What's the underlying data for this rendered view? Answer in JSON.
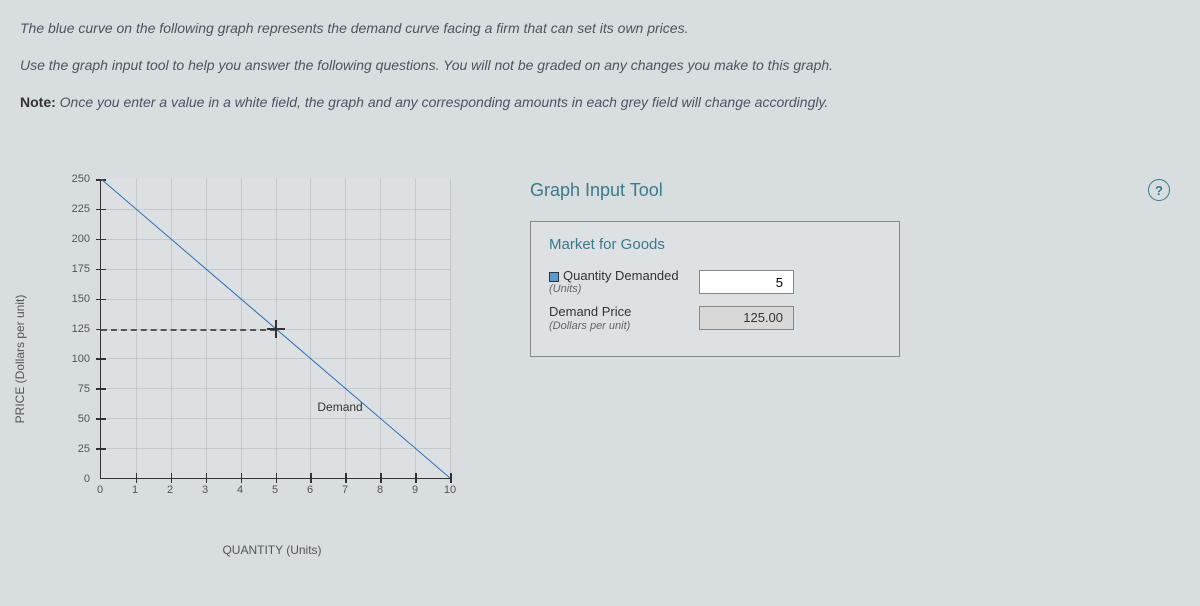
{
  "instructions": {
    "line1": "The blue curve on the following graph represents the demand curve facing a firm that can set its own prices.",
    "line2": "Use the graph input tool to help you answer the following questions. You will not be graded on any changes you make to this graph.",
    "note_label": "Note:",
    "note_text": " Once you enter a value in a white field, the graph and any corresponding amounts in each grey field will change accordingly."
  },
  "chart": {
    "y_label": "PRICE (Dollars per unit)",
    "x_label": "QUANTITY (Units)",
    "demand_label": "Demand",
    "y_ticks": [
      "250",
      "225",
      "200",
      "175",
      "150",
      "125",
      "100",
      "75",
      "50",
      "25",
      "0"
    ],
    "x_ticks": [
      "0",
      "1",
      "2",
      "3",
      "4",
      "5",
      "6",
      "7",
      "8",
      "9",
      "10"
    ]
  },
  "chart_data": {
    "type": "line",
    "title": "",
    "xlabel": "QUANTITY (Units)",
    "ylabel": "PRICE (Dollars per unit)",
    "xlim": [
      0,
      10
    ],
    "ylim": [
      0,
      250
    ],
    "series": [
      {
        "name": "Demand",
        "x": [
          0,
          10
        ],
        "y": [
          250,
          0
        ]
      }
    ],
    "marker": {
      "x": 5,
      "y": 125
    },
    "annotations": [
      {
        "text": "Demand",
        "x": 7,
        "y": 55
      }
    ]
  },
  "tool": {
    "title": "Graph Input Tool",
    "help": "?",
    "section_title": "Market for Goods",
    "quantity": {
      "label": "Quantity Demanded",
      "sublabel": "(Units)",
      "value": "5"
    },
    "price": {
      "label": "Demand Price",
      "sublabel": "(Dollars per unit)",
      "value": "125.00"
    }
  }
}
